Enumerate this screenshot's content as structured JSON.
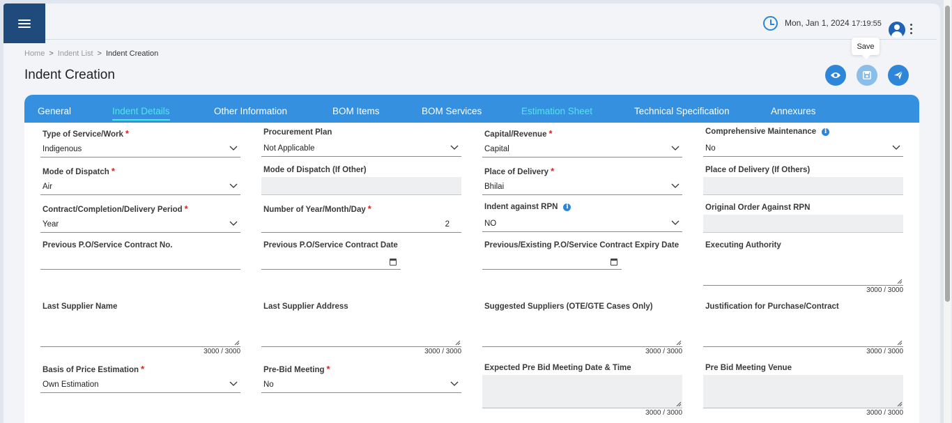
{
  "header": {
    "datetime_date": "Mon, Jan 1, 2024",
    "datetime_time": "17:19:55"
  },
  "breadcrumb": {
    "home": "Home",
    "list": "Indent List",
    "current": "Indent Creation",
    "separator": ">"
  },
  "page": {
    "title": "Indent Creation",
    "tooltip": "Save"
  },
  "tabs": [
    {
      "label": "General"
    },
    {
      "label": "Indent Details"
    },
    {
      "label": "Other Information"
    },
    {
      "label": "BOM Items"
    },
    {
      "label": "BOM Services"
    },
    {
      "label": "Estimation Sheet"
    },
    {
      "label": "Technical Specification"
    },
    {
      "label": "Annexures"
    }
  ],
  "fields": {
    "type_of_service": {
      "label": "Type of Service/Work",
      "value": "Indigenous"
    },
    "procurement_plan": {
      "label": "Procurement Plan",
      "value": "Not Applicable"
    },
    "capital_revenue": {
      "label": "Capital/Revenue",
      "value": "Capital"
    },
    "comprehensive_maintenance": {
      "label": "Comprehensive Maintenance",
      "value": "No"
    },
    "mode_of_dispatch": {
      "label": "Mode of Dispatch",
      "value": "Air"
    },
    "mode_of_dispatch_other": {
      "label": "Mode of Dispatch (If Other)"
    },
    "place_of_delivery": {
      "label": "Place of Delivery",
      "value": "Bhilai"
    },
    "place_of_delivery_others": {
      "label": "Place of Delivery (If Others)"
    },
    "contract_period": {
      "label": "Contract/Completion/Delivery Period",
      "value": "Year"
    },
    "number_period": {
      "label": "Number of Year/Month/Day",
      "value": "2"
    },
    "indent_against_rpn": {
      "label": "Indent against RPN",
      "value": "NO"
    },
    "original_order_rpn": {
      "label": "Original Order Against RPN"
    },
    "previous_po_no": {
      "label": "Previous P.O/Service Contract No."
    },
    "previous_po_date": {
      "label": "Previous P.O/Service Contract Date"
    },
    "previous_po_expiry": {
      "label": "Previous/Existing P.O/Service Contract Expiry Date"
    },
    "executing_authority": {
      "label": "Executing Authority",
      "counter": "3000 / 3000"
    },
    "last_supplier_name": {
      "label": "Last Supplier Name",
      "counter": "3000 / 3000"
    },
    "last_supplier_address": {
      "label": "Last Supplier Address",
      "counter": "3000 / 3000"
    },
    "suggested_suppliers": {
      "label": "Suggested Suppliers (OTE/GTE Cases Only)",
      "counter": "3000 / 3000"
    },
    "justification": {
      "label": "Justification for Purchase/Contract",
      "counter": "3000 / 3000"
    },
    "basis_price_estimation": {
      "label": "Basis of Price Estimation",
      "value": "Own Estimation"
    },
    "pre_bid_meeting": {
      "label": "Pre-Bid Meeting",
      "value": "No"
    },
    "pre_bid_datetime": {
      "label": "Expected Pre Bid Meeting Date & Time",
      "counter": "3000 / 3000"
    },
    "pre_bid_venue": {
      "label": "Pre Bid Meeting Venue",
      "counter": "3000 / 3000"
    }
  },
  "required_mark": "*",
  "info_glyph": "i",
  "colors": {
    "primary": "#3590e0",
    "active_tab": "#4fe8e8",
    "menu": "#1f4a7c",
    "required": "#e02020"
  }
}
